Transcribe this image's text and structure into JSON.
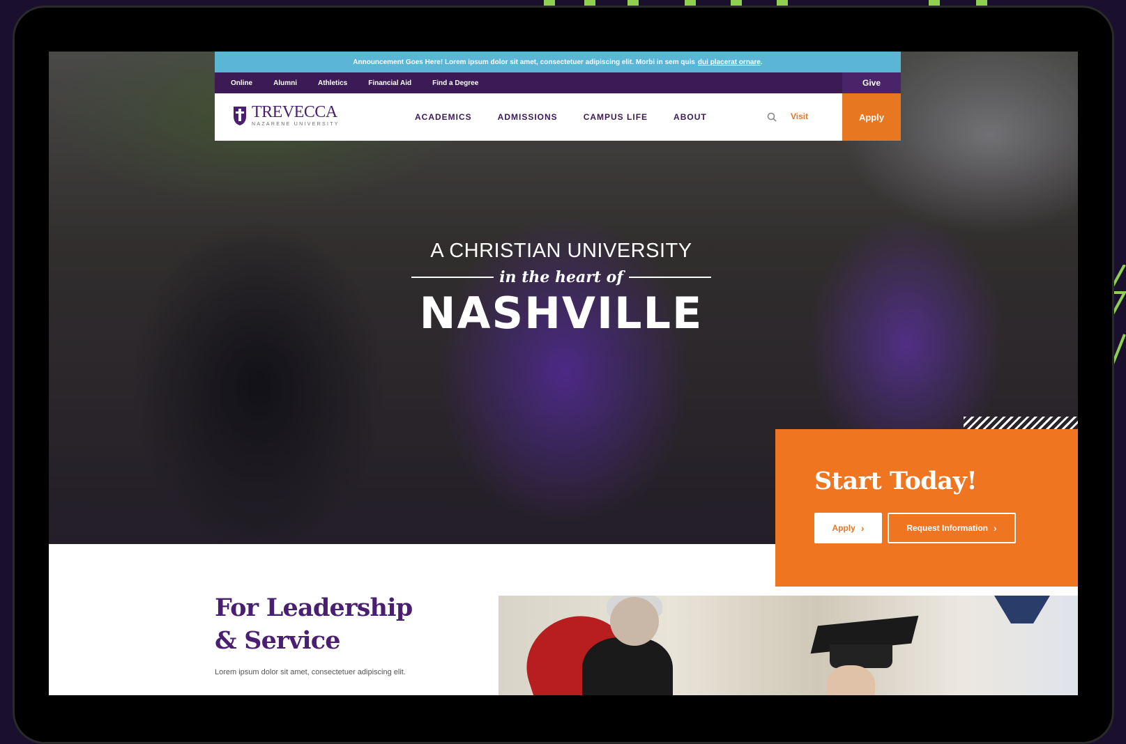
{
  "announcement": {
    "text": "Announcement Goes Here! Lorem ipsum dolor sit amet, consectetuer adipiscing elit. Morbi in sem quis",
    "link": "dui placerat ornare",
    "suffix": "."
  },
  "utility_nav": {
    "items": [
      "Online",
      "Alumni",
      "Athletics",
      "Financial Aid",
      "Find a Degree"
    ],
    "give": "Give"
  },
  "logo": {
    "name": "TREVECCA",
    "subtitle": "NAZARENE UNIVERSITY"
  },
  "main_nav": {
    "items": [
      "ACADEMICS",
      "ADMISSIONS",
      "CAMPUS LIFE",
      "ABOUT"
    ],
    "search_icon": "search-icon",
    "visit": "Visit",
    "apply": "Apply"
  },
  "hero": {
    "line1": "A CHRISTIAN UNIVERSITY",
    "line2": "in the heart of",
    "line3": "NASHVILLE"
  },
  "cta": {
    "title": "Start Today!",
    "apply": "Apply",
    "request_info": "Request Information",
    "chevron": "›"
  },
  "lead": {
    "title_line1": "For Leadership",
    "title_line2": "& Service",
    "body": "Lorem ipsum dolor sit amet, consectetuer adipiscing elit."
  },
  "colors": {
    "purple": "#3b1a56",
    "orange": "#ef7521",
    "announce_blue": "#5bb5d5",
    "accent_green": "#8fd14f"
  }
}
